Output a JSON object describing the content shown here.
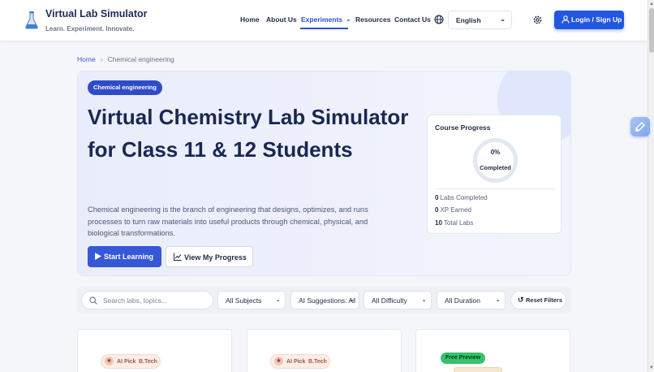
{
  "header": {
    "brand_title": "Virtual Lab Simulator",
    "brand_tagline": "Learn. Experiment. Innovate.",
    "nav": [
      {
        "label": "Home"
      },
      {
        "label": "About Us"
      },
      {
        "label": "Experiments",
        "active": true
      },
      {
        "label": "Resources"
      },
      {
        "label": "Contact Us"
      }
    ],
    "language": "English",
    "login_label": "Login / Sign Up",
    "accent_color": "#2457e0"
  },
  "breadcrumb": {
    "home": "Home",
    "current": "Chemical engineering"
  },
  "hero": {
    "badge": "Chemical engineering",
    "title": "Virtual Chemistry Lab Simulator for Class 11 & 12 Students",
    "description": "Chemical engineering is the branch of engineering that designs, optimizes, and runs processes to turn raw materials into useful products through chemical, physical, and biological transformations.",
    "start_button": "Start Learning",
    "progress_button": "View My Progress"
  },
  "progress": {
    "title": "Course Progress",
    "percent_label": "0%",
    "percent_value": 0,
    "status_label": "Completed",
    "stats": [
      {
        "value": "0",
        "label": "Labs Completed"
      },
      {
        "value": "0",
        "label": "XP Earned"
      },
      {
        "value": "10",
        "label": "Total Labs"
      }
    ]
  },
  "filters": {
    "search_placeholder": "Search labs, topics...",
    "subject": "All Subjects",
    "suggestions": "AI Suggestions: All",
    "difficulty": "All Difficulty",
    "duration": "All Duration",
    "reset": "Reset Filters"
  },
  "cards": [
    {
      "tag1": "AI Pick",
      "tag2": "B.Tech"
    },
    {
      "tag1": "AI Pick",
      "tag2": "B.Tech"
    },
    {
      "tag": "Free Preview"
    }
  ]
}
